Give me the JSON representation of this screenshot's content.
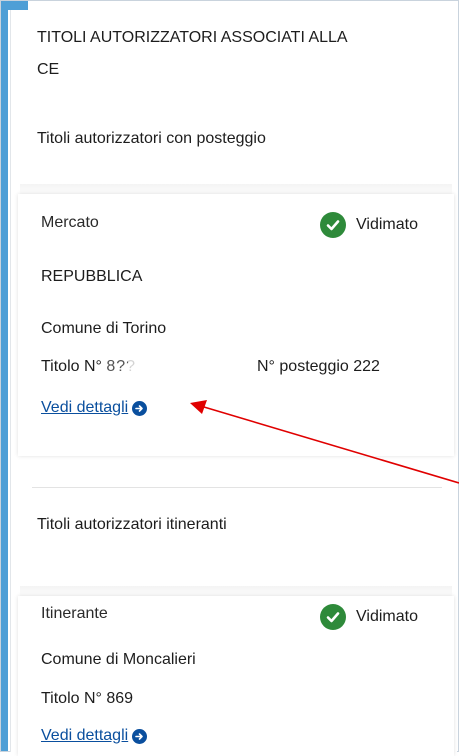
{
  "header": {
    "title_line1": "TITOLI AUTORIZZATORI ASSOCIATI ALLA",
    "title_line2": "CE"
  },
  "sections": {
    "posteggio_title": "Titoli autorizzatori con posteggio",
    "itineranti_title": "Titoli autorizzatori itineranti"
  },
  "card1": {
    "type_label": "Mercato",
    "status": "Vidimato",
    "market_name": "REPUBBLICA",
    "comune_prefix": "Comune di ",
    "comune_name": "Torino",
    "titolo_prefix": "Titolo N° ",
    "titolo_value": "8??",
    "posteggio_label": "N° posteggio 222",
    "link_label": "Vedi dettagli"
  },
  "card2": {
    "type_label": "Itinerante",
    "status": "Vidimato",
    "comune_label": "Comune di Moncalieri",
    "titolo_prefix": "Titolo N° ",
    "titolo_value": "869",
    "link_label": "Vedi dettagli"
  },
  "colors": {
    "accent": "#4f9fd6",
    "check_green": "#2e8a3a",
    "link_blue": "#0a4f9e",
    "annotation_red": "#e00000"
  }
}
